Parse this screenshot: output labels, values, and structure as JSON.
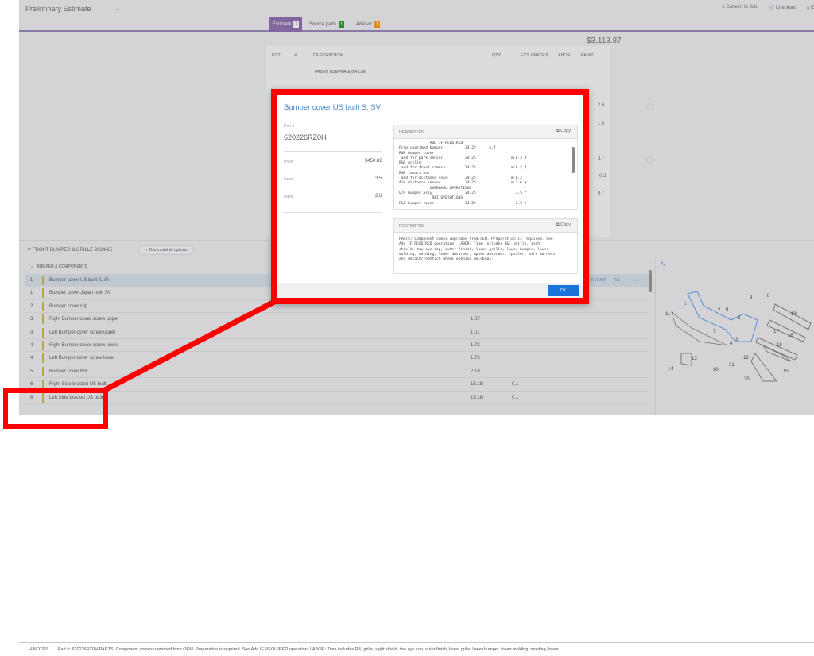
{
  "header": {
    "title": "Preliminary Estimate",
    "actions": [
      "Convert to Job",
      "Checkout",
      "E"
    ]
  },
  "tabs": [
    {
      "label": "Estimate",
      "badge": "2",
      "color": "#555"
    },
    {
      "label": "Source parts",
      "badge": "1",
      "color": "#2e8b2e"
    },
    {
      "label": "Advisor",
      "badge": "1",
      "color": "#e08a1e"
    }
  ],
  "total": "$3,113.87",
  "estimate": {
    "columns": [
      "EST",
      "#",
      "DESCRIPTION",
      "QTY",
      "EXT. PRICE $",
      "LABOR",
      "PAINT"
    ],
    "section": "FRONT BUMPER & GRILLE",
    "paint_values": [
      "2.6",
      "1.0",
      "3.7",
      "-0.2",
      "0.7"
    ]
  },
  "lower": {
    "section_title": "FRONT BUMPER & GRILLE 2024-25",
    "filter": "This model w/ options",
    "group": "BUMPER & COMPONENTS",
    "rows": [
      {
        "n": "1",
        "desc": "Bumper cover US built S, SV",
        "price": "",
        "labor": "",
        "selected": true
      },
      {
        "n": "1",
        "desc": "Bumper cover Japan built SV",
        "price": "",
        "labor": ""
      },
      {
        "n": "2",
        "desc": "Bumper cover clip",
        "price": "",
        "labor": ""
      },
      {
        "n": "3",
        "desc": "Right Bumper cover screw upper",
        "price": "1.07",
        "labor": ""
      },
      {
        "n": "3",
        "desc": "Left Bumper cover screw upper",
        "price": "1.07",
        "labor": ""
      },
      {
        "n": "4",
        "desc": "Right Bumper cover screw lower",
        "price": "1.73",
        "labor": ""
      },
      {
        "n": "4",
        "desc": "Left Bumper cover screw lower",
        "price": "1.73",
        "labor": ""
      },
      {
        "n": "5",
        "desc": "Bumper cover bolt",
        "price": "2.18",
        "labor": ""
      },
      {
        "n": "6",
        "desc": "Right Side bracket US built",
        "price": "15.18",
        "labor": "0.1"
      },
      {
        "n": "6",
        "desc": "Left Side bracket US built",
        "price": "15.18",
        "labor": "0.1"
      }
    ],
    "row_actions": [
      "REPAIR",
      "R&I",
      "..."
    ],
    "hnotes_label": "H-NOTES",
    "hnotes_text": "Part #: 620226RZ0H     PARTS: Component comes unprimed from OEM. Preparation is required. See Add IF REQUIRED operation. LABOR: Time includes R&I grille, sight shield, tow eye cap, outer finish, lower grille, lower bumper, lower molding, molding, lower..."
  },
  "diagram": {
    "callouts": [
      "1",
      "2",
      "3",
      "3",
      "4",
      "6",
      "7",
      "8",
      "9",
      "10",
      "11",
      "12",
      "13",
      "14",
      "15",
      "16",
      "17",
      "18",
      "19",
      "20",
      "21"
    ]
  },
  "modal": {
    "title": "Bumper cover US built S, SV",
    "part_label": "Part #",
    "part_number": "620226RZ0H",
    "price_label": "Price",
    "price": "$450.82",
    "labor_label": "Labor",
    "labor": "3.5",
    "paint_label": "Paint",
    "paint": "2.6",
    "headnotes_label": "HEADNOTES",
    "copy_label": "Copy",
    "headnotes": "              ADD IF REQUIRED\nPrep unprimed bumper          24-25      p.7\nR&R bumper cover\n add for park sensor          24-25                m 0.3 #\nR&R grille\n add for front camera         24-25                m 0.2 ¶\nR&R impact bar\n add for distance sens        24-25                m 0.2\nAim distance sensor           24-25                m 1.6 @\n              OVERHAUL OPERATIONS\nO/H bumper assy               24-25                  3.5 *\n               R&I OPERATIONS\nR&I bumper cover              24-25                  2.3 ¥",
    "footnotes_label": "FOOTNOTES",
    "footnotes": "PARTS: Component comes unprimed from OEM. Preparation is required. See\nAdd IF REQUIRED operation. LABOR: Time includes R&I grille, sight\nshield, tow eye cap, outer finish, lower grille, lower bumper, lower\nmolding, molding, lower absorber, upper absorber, spoiler, wire harness\nand detach/reattach wheel opening moldings.",
    "ok_label": "OK"
  },
  "annotation": {
    "color": "#ff0000"
  }
}
